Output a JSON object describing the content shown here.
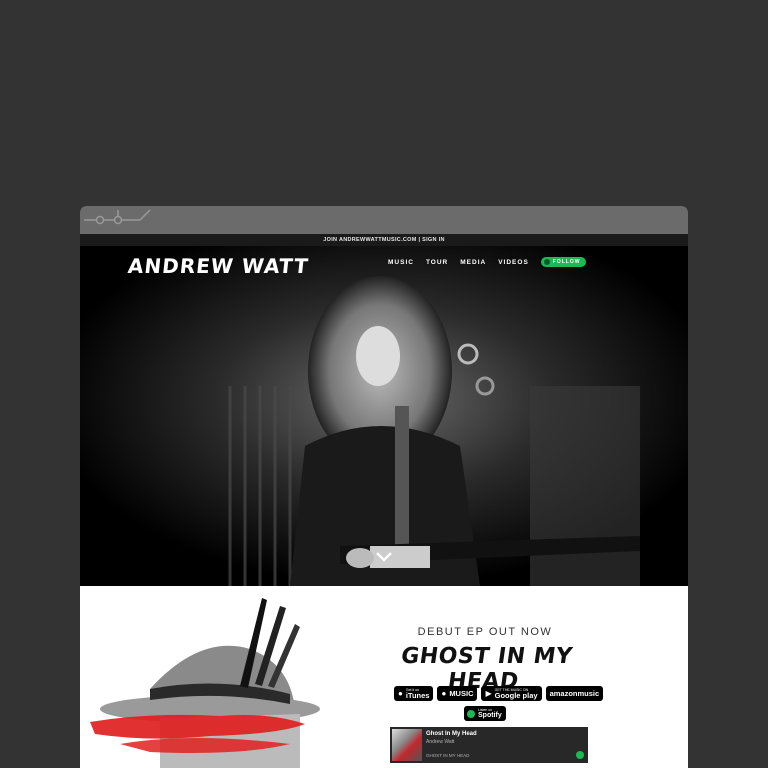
{
  "topbar": {
    "text": "JOIN ANDREWWATTMUSIC.COM | SIGN IN"
  },
  "header": {
    "logo": "ANDREW WATT",
    "nav": [
      "MUSIC",
      "TOUR",
      "MEDIA",
      "VIDEOS"
    ],
    "follow_label": "FOLLOW"
  },
  "release": {
    "kicker": "DEBUT EP OUT NOW",
    "title": "GHOST IN MY HEAD",
    "stores": [
      {
        "small": "Get it on",
        "big": "iTunes",
        "icon": "apple-icon"
      },
      {
        "small": "",
        "big": "MUSIC",
        "icon": "apple-icon"
      },
      {
        "small": "GET THE MUSIC ON",
        "big": "Google play",
        "icon": "play-icon"
      },
      {
        "small": "",
        "big": "amazonmusic",
        "icon": "amazon-icon"
      }
    ],
    "spotify": {
      "small": "Listen on",
      "big": "Spotify"
    }
  },
  "player": {
    "track": "Ghost In My Head",
    "artist": "Andrew Watt",
    "now_playing": "GHOST IN MY HEAD"
  },
  "colors": {
    "accent_green": "#1db954",
    "paint_red": "#e02020"
  }
}
